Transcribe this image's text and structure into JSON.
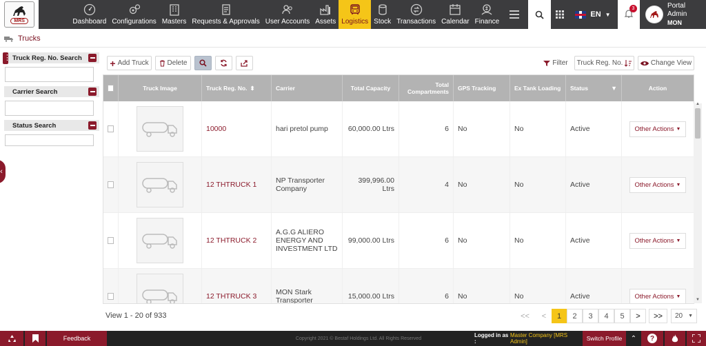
{
  "nav": {
    "items": [
      {
        "label": "Dashboard",
        "icon": "dashboard-icon"
      },
      {
        "label": "Configurations",
        "icon": "gears-icon"
      },
      {
        "label": "Masters",
        "icon": "building-icon"
      },
      {
        "label": "Requests & Approvals",
        "icon": "document-icon"
      },
      {
        "label": "User Accounts",
        "icon": "users-icon"
      },
      {
        "label": "Assets",
        "icon": "factory-icon"
      },
      {
        "label": "Logistics",
        "icon": "truck-front-icon",
        "active": true
      },
      {
        "label": "Stock",
        "icon": "stock-icon"
      },
      {
        "label": "Transactions",
        "icon": "transactions-icon"
      },
      {
        "label": "Calendar",
        "icon": "calendar-icon"
      },
      {
        "label": "Finance",
        "icon": "finance-icon"
      }
    ],
    "language": "EN",
    "notification_count": "3",
    "user_name": "Portal Admin",
    "user_company": "MON",
    "logo_text": "MRS"
  },
  "breadcrumb": {
    "label": "Trucks"
  },
  "left_panel": {
    "sections": [
      {
        "title": "Truck Reg. No. Search",
        "value": ""
      },
      {
        "title": "Carrier Search",
        "value": ""
      },
      {
        "title": "Status Search",
        "value": ""
      }
    ]
  },
  "toolbar": {
    "add_label": "Add Truck",
    "delete_label": "Delete",
    "filter_label": "Filter",
    "sort_label": "Truck Reg. No.",
    "change_view_label": "Change View"
  },
  "grid": {
    "columns": [
      "Truck Image",
      "Truck Reg. No.",
      "Carrier",
      "Total Capacity",
      "Total Compartments",
      "GPS Tracking",
      "Ex Tank Loading",
      "Status",
      "Action"
    ],
    "rows": [
      {
        "reg": "10000",
        "carrier": "hari pretol pump",
        "capacity": "60,000.00 Ltrs",
        "compartments": "6",
        "gps": "No",
        "extank": "No",
        "status": "Active",
        "action": "Other Actions"
      },
      {
        "reg": "12 THTRUCK 1",
        "carrier": "NP Transporter Company",
        "capacity": "399,996.00 Ltrs",
        "compartments": "4",
        "gps": "No",
        "extank": "No",
        "status": "Active",
        "action": "Other Actions"
      },
      {
        "reg": "12 THTRUCK 2",
        "carrier": "A.G.G ALIERO ENERGY AND INVESTMENT LTD",
        "capacity": "99,000.00 Ltrs",
        "compartments": "6",
        "gps": "No",
        "extank": "No",
        "status": "Active",
        "action": "Other Actions"
      },
      {
        "reg": "12 THTRUCK 3",
        "carrier": "MON Stark Transporter",
        "capacity": "15,000.00 Ltrs",
        "compartments": "6",
        "gps": "No",
        "extank": "No",
        "status": "Active",
        "action": "Other Actions"
      }
    ]
  },
  "pagination": {
    "info": "View 1 - 20 of 933",
    "first": "<<",
    "prev": "<",
    "pages": [
      "1",
      "2",
      "3",
      "4",
      "5"
    ],
    "current": "1",
    "next": ">",
    "last": ">>",
    "page_size": "20"
  },
  "footer": {
    "feedback": "Feedback",
    "copyright": "Copyright 2021 © Bestaf Holdings Ltd. All Rights Reserved",
    "logged_in_label": "Logged in as :",
    "logged_in_value": "Master Company [MRS Admin]",
    "switch_profile": "Switch Profile"
  },
  "colors": {
    "brand": "#8b1a2b",
    "nav_bg": "#3c3c3e",
    "active_tab": "#f5c518",
    "header_bg": "#b3b3b3"
  }
}
